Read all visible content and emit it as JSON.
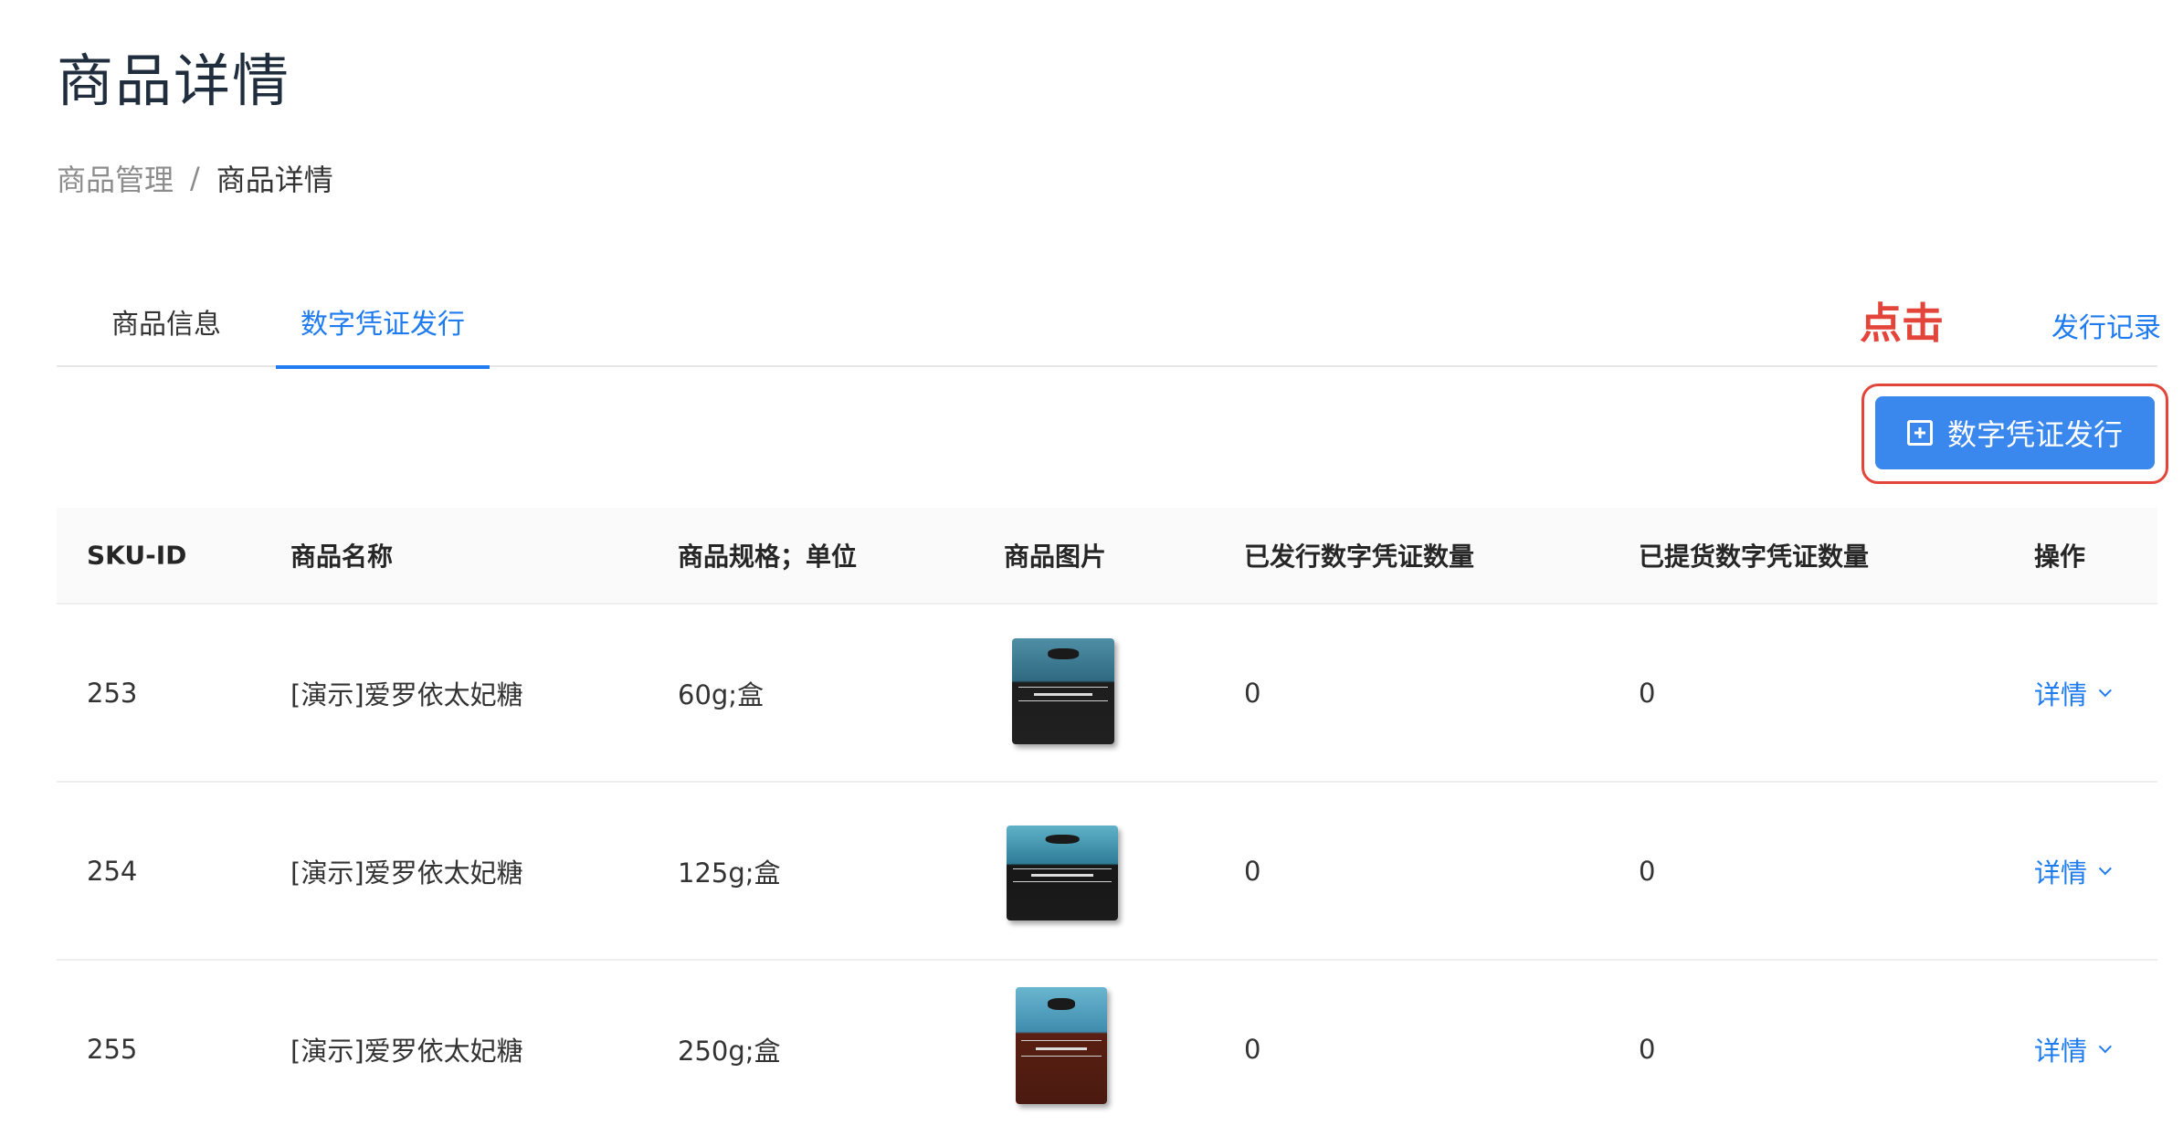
{
  "header": {
    "title": "商品详情"
  },
  "breadcrumb": {
    "parent": "商品管理",
    "separator": "/",
    "current": "商品详情"
  },
  "tabs": [
    {
      "label": "商品信息",
      "active": false
    },
    {
      "label": "数字凭证发行",
      "active": true
    }
  ],
  "annotation": {
    "text": "点击",
    "color": "#e4453a"
  },
  "toolbar": {
    "record_link": "发行记录",
    "issue_button": "数字凭证发行",
    "issue_button_icon": "plus-square-icon"
  },
  "colors": {
    "accent": "#1e7bf0",
    "button": "#3a87ee",
    "highlight": "#e4453a"
  },
  "table": {
    "columns": [
      "SKU-ID",
      "商品名称",
      "商品规格；单位",
      "商品图片",
      "已发行数字凭证数量",
      "已提货数字凭证数量",
      "操作"
    ],
    "rows": [
      {
        "sku": "253",
        "name": "[演示]爱罗依太妃糖",
        "spec": "60g;盒",
        "image": "almond-toffee-box-small",
        "issued": "0",
        "picked": "0",
        "action": "详情"
      },
      {
        "sku": "254",
        "name": "[演示]爱罗依太妃糖",
        "spec": "125g;盒",
        "image": "almond-toffee-box-medium",
        "issued": "0",
        "picked": "0",
        "action": "详情"
      },
      {
        "sku": "255",
        "name": "[演示]爱罗依太妃糖",
        "spec": "250g;盒",
        "image": "almond-toffee-box-large",
        "issued": "0",
        "picked": "0",
        "action": "详情"
      }
    ]
  }
}
